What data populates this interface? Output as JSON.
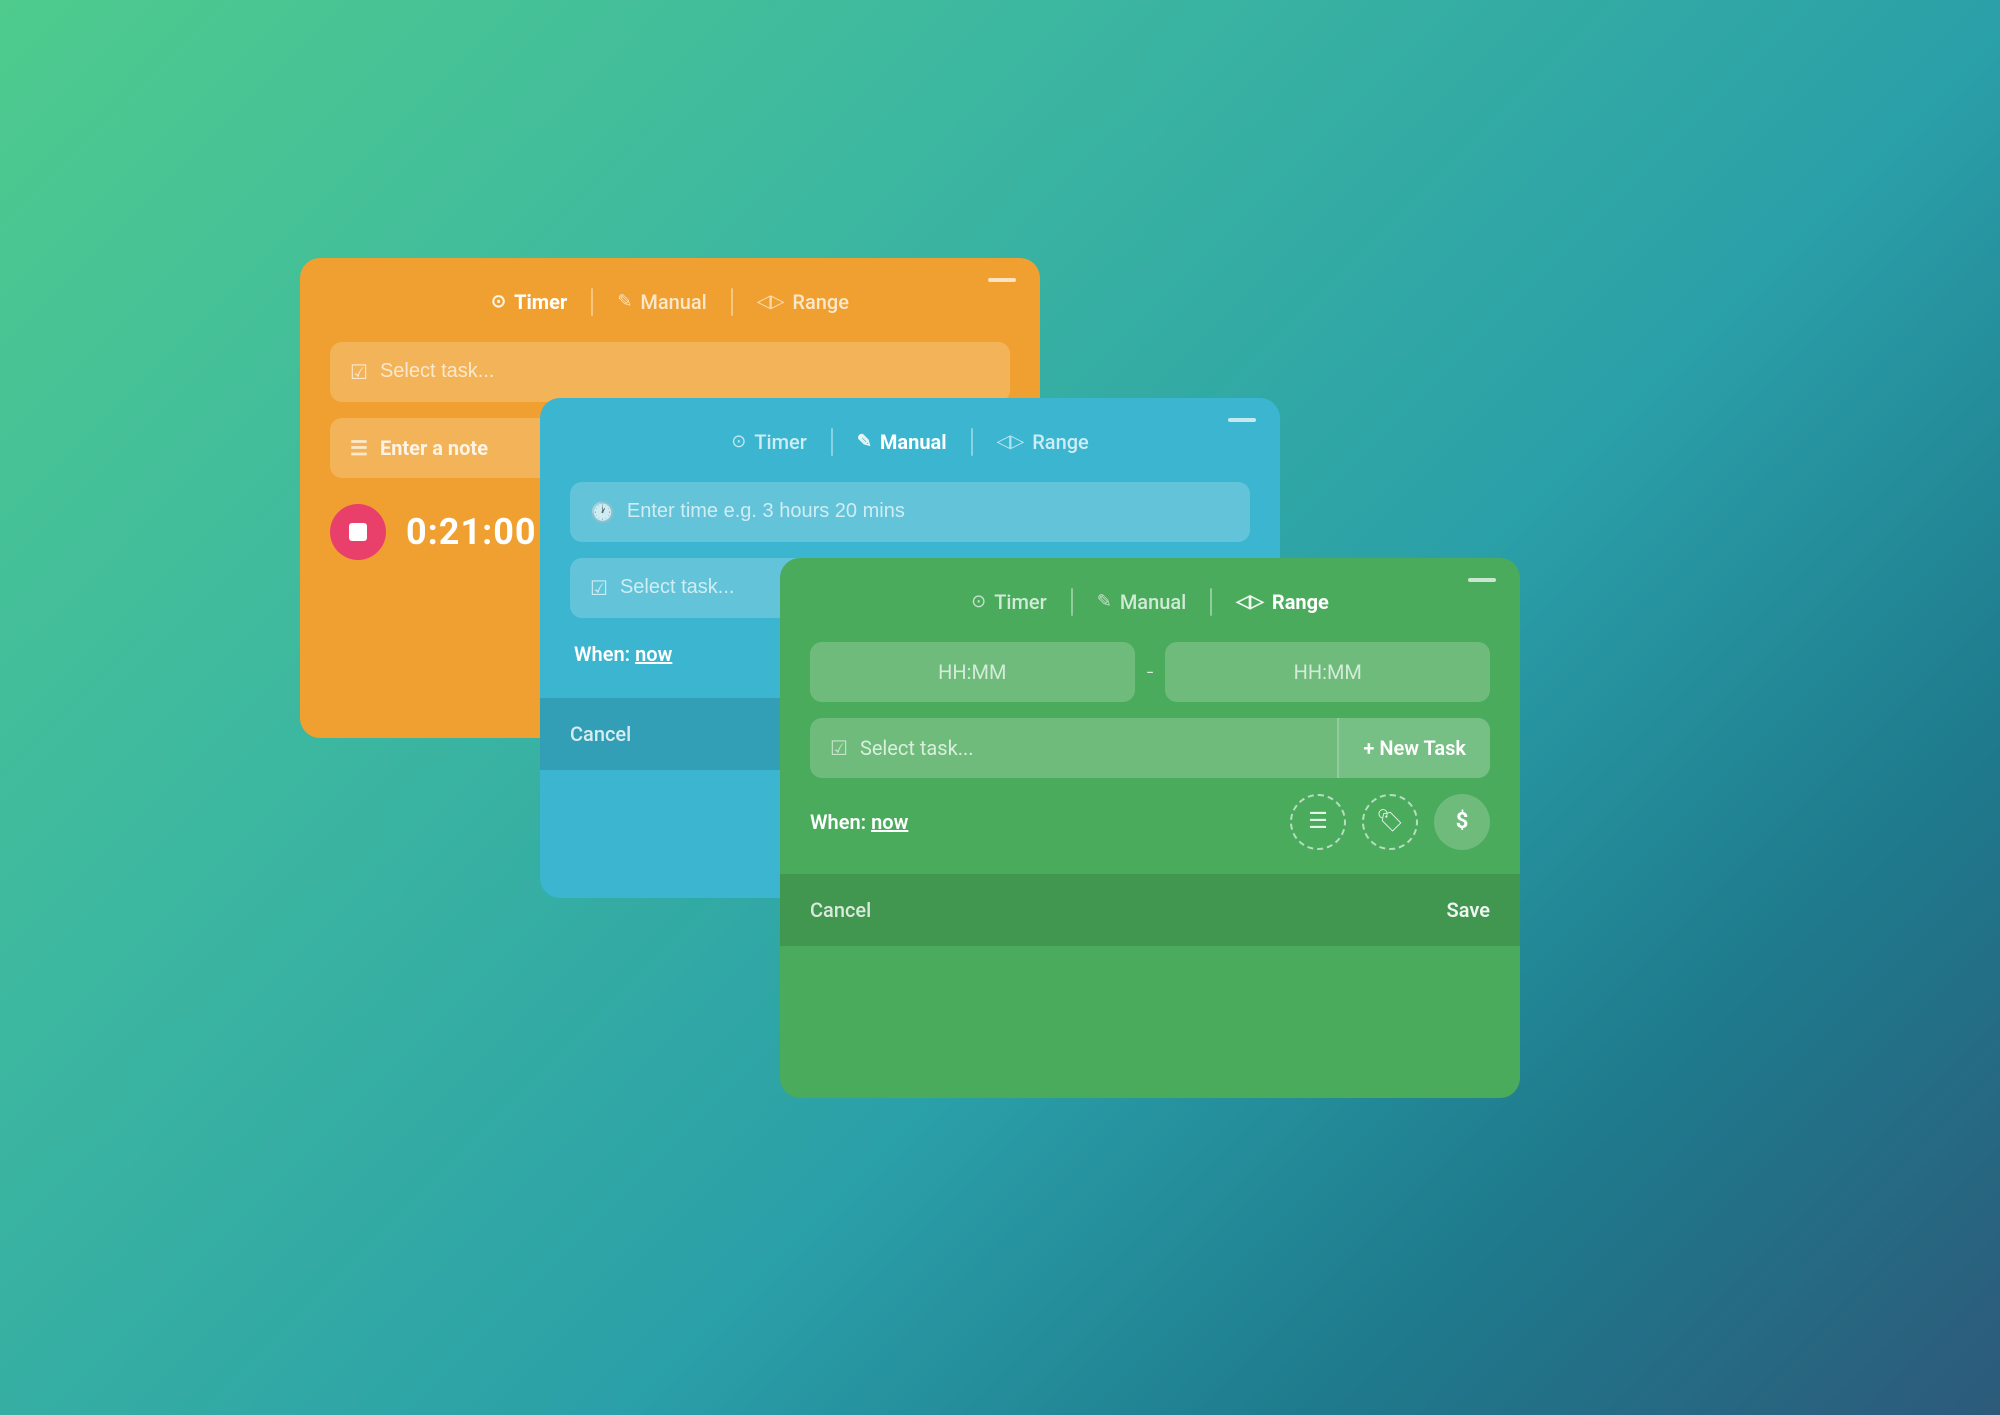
{
  "cards": {
    "orange": {
      "color": "#f0a030",
      "tabs": [
        {
          "label": "Timer",
          "icon": "▶",
          "active": true
        },
        {
          "label": "Manual",
          "icon": "✎",
          "active": false
        },
        {
          "label": "Range",
          "icon": "◁▷",
          "active": false
        }
      ],
      "select_task_placeholder": "Select task...",
      "note_placeholder": "Enter a note",
      "timer_value": "0:21:00",
      "minimize_label": "—"
    },
    "blue": {
      "color": "#3bb5d0",
      "tabs": [
        {
          "label": "Timer",
          "icon": "▶",
          "active": false
        },
        {
          "label": "Manual",
          "icon": "✎",
          "active": true
        },
        {
          "label": "Range",
          "icon": "◁▷",
          "active": false
        }
      ],
      "time_placeholder": "Enter time e.g. 3 hours 20 mins",
      "select_task_placeholder": "Select task...",
      "when_label": "When:",
      "when_value": "now",
      "cancel_label": "Cancel",
      "minimize_label": "—"
    },
    "green": {
      "color": "#4aab5c",
      "tabs": [
        {
          "label": "Timer",
          "icon": "▶",
          "active": false
        },
        {
          "label": "Manual",
          "icon": "✎",
          "active": false
        },
        {
          "label": "Range",
          "icon": "◁▷",
          "active": true
        }
      ],
      "start_placeholder": "HH:MM",
      "end_placeholder": "HH:MM",
      "separator": "-",
      "select_task_placeholder": "Select task...",
      "new_task_label": "+ New Task",
      "when_label": "When:",
      "when_value": "now",
      "cancel_label": "Cancel",
      "save_label": "Save",
      "minimize_label": "—",
      "note_icon": "☰",
      "tag_icon": "🏷",
      "dollar_icon": "$"
    }
  }
}
